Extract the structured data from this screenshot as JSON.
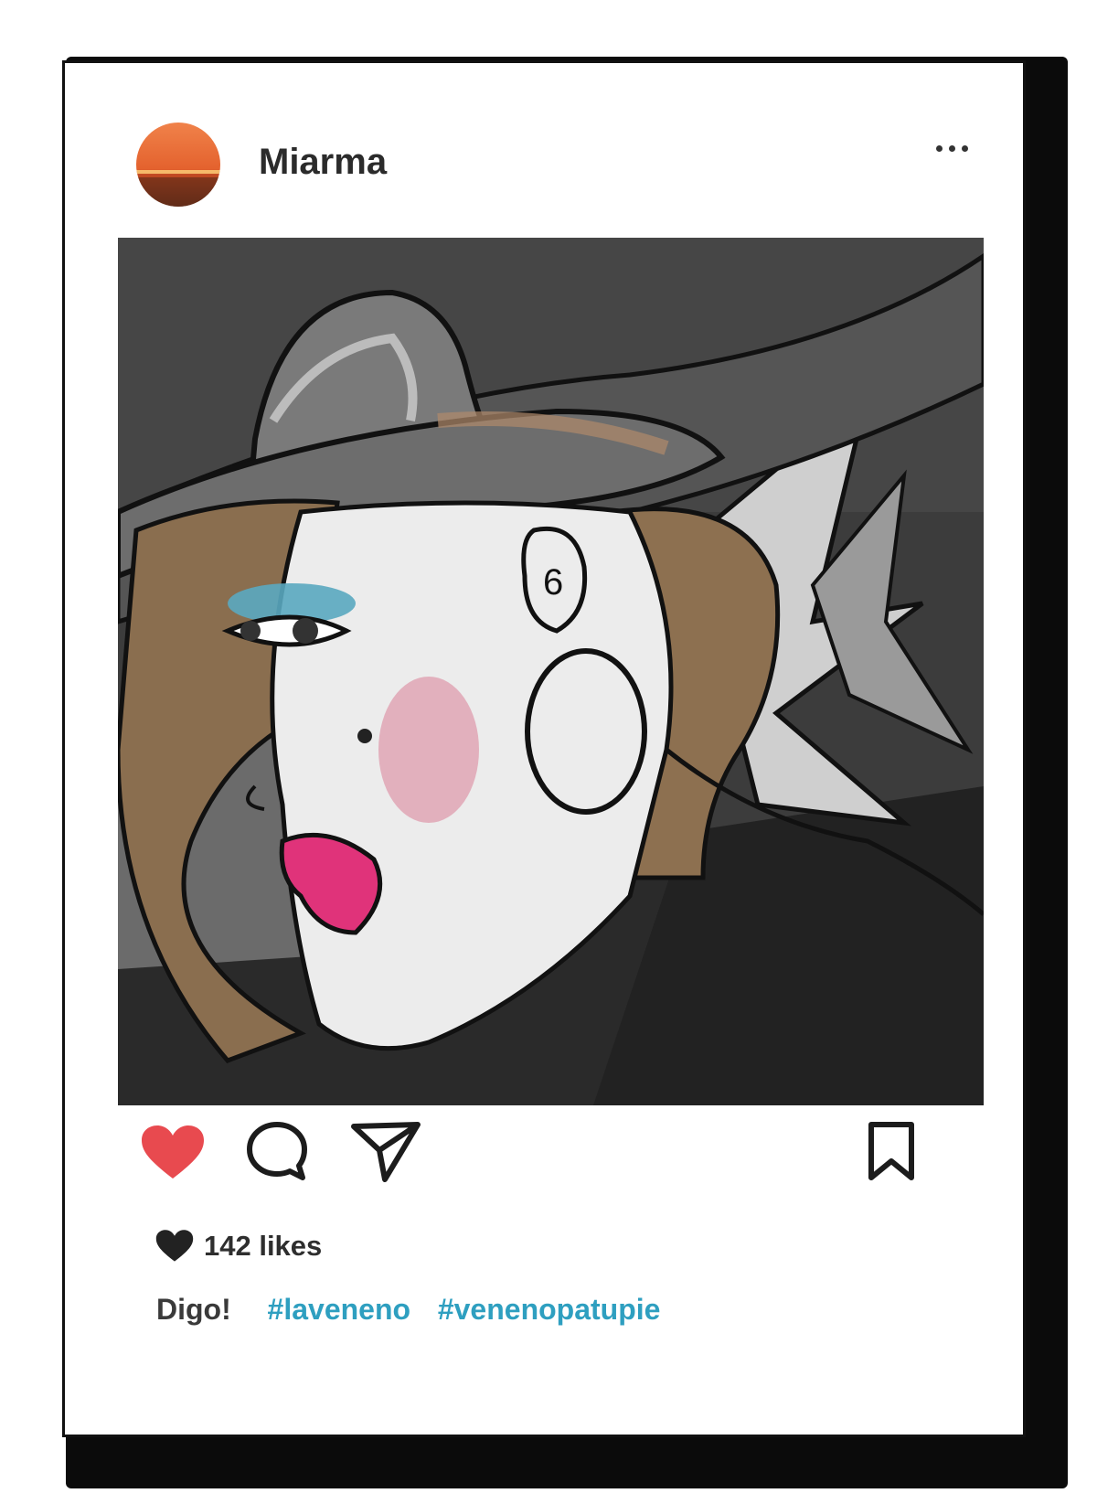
{
  "post": {
    "username": "Miarma",
    "likes_text": "142 likes",
    "caption": {
      "text": "Digo!",
      "hashtags": [
        "#laveneno",
        "#venenopatupie"
      ]
    }
  },
  "icons": {
    "more": "more-horizontal-icon",
    "like": "heart-filled-icon",
    "comment": "comment-icon",
    "share": "send-icon",
    "save": "bookmark-icon",
    "likes": "heart-small-icon"
  },
  "colors": {
    "like_red": "#e84a4f",
    "hashtag_blue": "#2e9fc0",
    "avatar_orange": "#e8743a"
  }
}
